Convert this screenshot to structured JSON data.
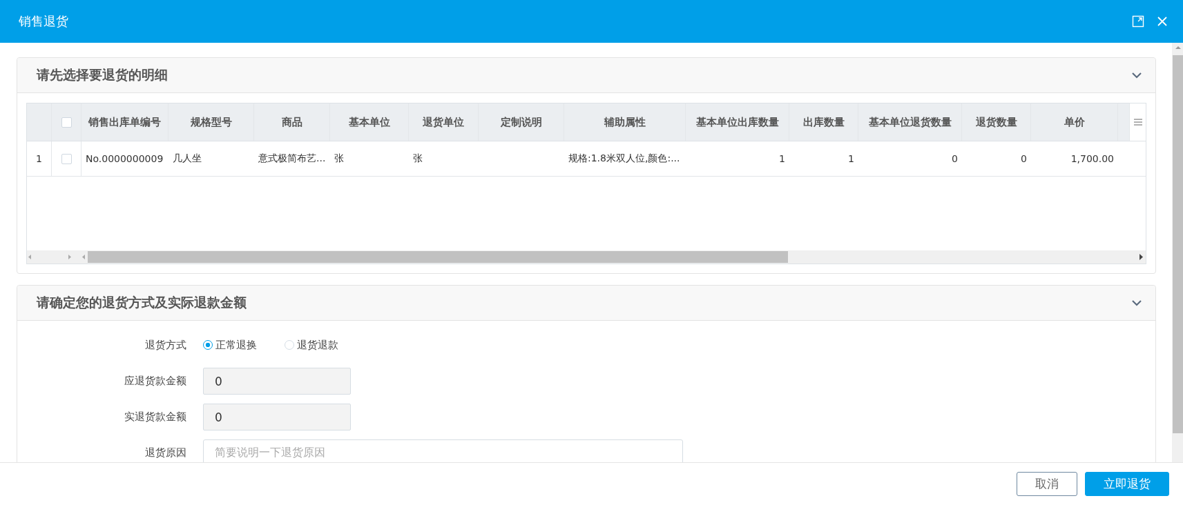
{
  "window": {
    "title": "销售退货"
  },
  "detail_section": {
    "title": "请先选择要退货的明细",
    "table": {
      "select_all": false,
      "columns": [
        {
          "label": "销售出库单编号",
          "kind": "text"
        },
        {
          "label": "规格型号",
          "kind": "text"
        },
        {
          "label": "商品",
          "kind": "text"
        },
        {
          "label": "基本单位",
          "kind": "text"
        },
        {
          "label": "退货单位",
          "kind": "text"
        },
        {
          "label": "定制说明",
          "kind": "text"
        },
        {
          "label": "辅助属性",
          "kind": "text"
        },
        {
          "label": "基本单位出库数量",
          "kind": "number"
        },
        {
          "label": "出库数量",
          "kind": "number"
        },
        {
          "label": "基本单位退货数量",
          "kind": "number"
        },
        {
          "label": "退货数量",
          "kind": "number"
        },
        {
          "label": "单价",
          "kind": "number"
        }
      ],
      "rows": [
        {
          "index": "1",
          "selected": false,
          "cells": [
            "No.0000000009",
            "几人坐",
            "意式极简布艺...",
            "张",
            "张",
            "",
            "规格:1.8米双人位,颜色:...",
            "1",
            "1",
            "0",
            "0",
            "1,700.00"
          ]
        }
      ]
    }
  },
  "refund_section": {
    "title": "请确定您的退货方式及实际退款金额",
    "method": {
      "label": "退货方式",
      "options": [
        {
          "label": "正常退换",
          "selected": true
        },
        {
          "label": "退货退款",
          "selected": false
        }
      ]
    },
    "fields": [
      {
        "label": "应退货款金额",
        "value": "0",
        "disabled": true,
        "kind": "input"
      },
      {
        "label": "实退货款金额",
        "value": "0",
        "disabled": true,
        "kind": "input"
      },
      {
        "label": "退货原因",
        "placeholder": "简要说明一下退货原因",
        "disabled": false,
        "kind": "textarea"
      }
    ]
  },
  "footer": {
    "buttons": [
      {
        "label": "取消",
        "kind": "secondary"
      },
      {
        "label": "立即退货",
        "kind": "primary"
      }
    ]
  }
}
